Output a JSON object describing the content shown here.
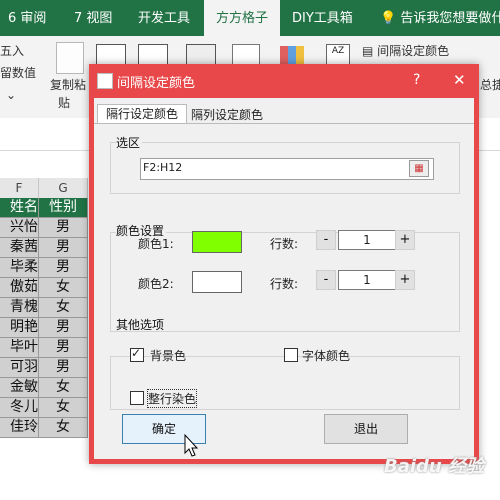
{
  "ribbon": {
    "tabs": [
      "6 审阅",
      "7 视图",
      "开发工具",
      "方方格子",
      "DIY工具箱"
    ],
    "tell_me": "告诉我您想要做什么",
    "partial_left_1": "五入",
    "partial_left_2": "留数值",
    "copy_paste": "复制粘",
    "paste_sub": "贴",
    "interval_color": "间隔设定颜色",
    "right_partial": "总捷"
  },
  "sheet": {
    "columns": [
      "F",
      "G"
    ],
    "header_row": [
      "姓名",
      "性别"
    ],
    "rows": [
      [
        "兴怡",
        "男"
      ],
      [
        "秦茜",
        "男"
      ],
      [
        "毕柔",
        "男"
      ],
      [
        "傲茹",
        "女"
      ],
      [
        "青槐",
        "女"
      ],
      [
        "明艳",
        "男"
      ],
      [
        "毕叶",
        "男"
      ],
      [
        "可羽",
        "男"
      ],
      [
        "金敏",
        "女"
      ],
      [
        "冬儿",
        "女"
      ],
      [
        "佳玲",
        "女"
      ]
    ],
    "header_color": "#217346",
    "data_fill": "#d0d0d0"
  },
  "dialog": {
    "title": "间隔设定颜色",
    "help": "?",
    "close": "✕",
    "tabs": [
      "隔行设定颜色",
      "隔列设定颜色"
    ],
    "selection_label": "选区",
    "selection_value": "F2:H12",
    "color_settings_label": "颜色设置",
    "color1_label": "颜色1:",
    "color1_value": "#80ff00",
    "color2_label": "颜色2:",
    "color2_value": "#ffffff",
    "rows_label_1": "行数:",
    "rows_value_1": "1",
    "rows_label_2": "行数:",
    "rows_value_2": "1",
    "minus": "-",
    "plus": "+",
    "other_options_label": "其他选项",
    "bg_color_label": "背景色",
    "bg_color_checked": true,
    "font_color_label": "字体颜色",
    "font_color_checked": false,
    "whole_row_label": "整行染色",
    "whole_row_checked": false,
    "ok": "确定",
    "exit": "退出"
  },
  "watermark": "Baidu 经验"
}
